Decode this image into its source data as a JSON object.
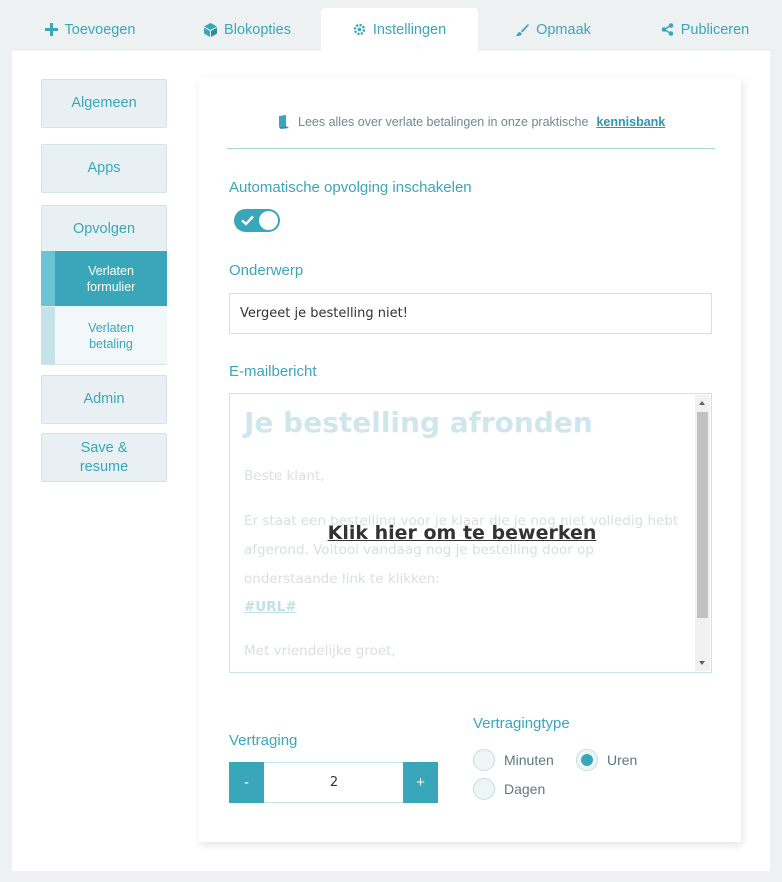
{
  "tabs": [
    {
      "label": "Toevoegen",
      "icon": "plus-icon"
    },
    {
      "label": "Blokopties",
      "icon": "cube-icon"
    },
    {
      "label": "Instellingen",
      "icon": "gear-icon",
      "active": true
    },
    {
      "label": "Opmaak",
      "icon": "brush-icon"
    },
    {
      "label": "Publiceren",
      "icon": "share-icon"
    }
  ],
  "sidebar": {
    "general": "Algemeen",
    "apps": "Apps",
    "followup": "Opvolgen",
    "sub_form": "Verlaten formulier",
    "sub_payment": "Verlaten betaling",
    "admin": "Admin",
    "save_resume": "Save & resume"
  },
  "info": {
    "text": "Lees alles over verlate betalingen in onze praktische",
    "link": "kennisbank",
    "icon": "book-icon"
  },
  "auto_followup": {
    "label": "Automatische opvolging inschakelen",
    "enabled": true
  },
  "subject": {
    "label": "Onderwerp",
    "value": "Vergeet je bestelling niet!"
  },
  "email": {
    "label": "E-mailbericht",
    "heading": "Je bestelling afronden",
    "greeting": "Beste klant,",
    "body": "Er staat een bestelling voor je klaar die je nog niet volledig hebt afgerond. Voltooi vandaag nog je bestelling door op onderstaande link te klikken:",
    "url": "#URL#",
    "closing": "Met vriendelijke groet,",
    "edit_overlay": "Klik hier om te bewerken"
  },
  "delay": {
    "label": "Vertraging",
    "minus": "-",
    "value": "2",
    "plus": "+"
  },
  "delay_type": {
    "label": "Vertragingtype",
    "minutes": "Minuten",
    "hours": "Uren",
    "days": "Dagen",
    "selected": "Uren"
  },
  "colors": {
    "accent": "#3aa6b9",
    "background": "#eef1f2"
  }
}
